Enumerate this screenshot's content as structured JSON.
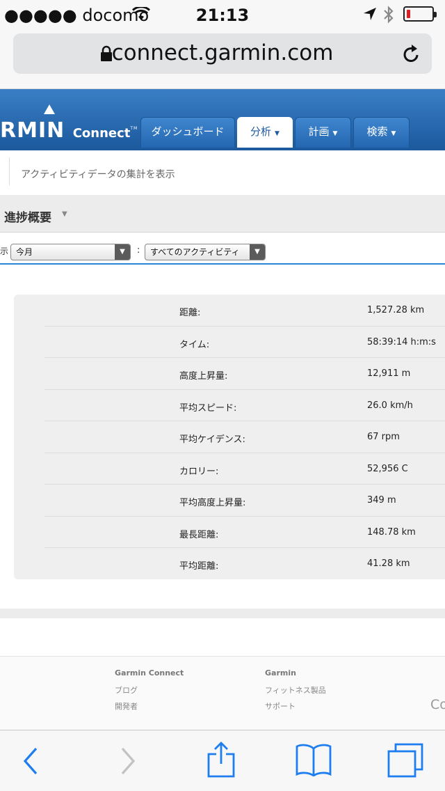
{
  "status_bar": {
    "carrier": "●●●●● docomo",
    "time": "21:13",
    "icons": [
      "wifi-icon",
      "location-arrow-icon",
      "bluetooth-icon",
      "battery-icon"
    ],
    "battery_color": "#e02020"
  },
  "url_bar": {
    "url": "connect.garmin.com",
    "icons": [
      "lock-icon",
      "reload-icon"
    ]
  },
  "garmin_header": {
    "logo_text": "RMIN",
    "logo_connect": "Connect",
    "logo_tm": "TM",
    "brand_color": "#1d5a9e",
    "tabs": [
      {
        "label": "ダッシュボード",
        "active": false
      },
      {
        "label": "分析",
        "active": true
      },
      {
        "label": "計画",
        "active": false
      },
      {
        "label": "検索",
        "active": false
      }
    ]
  },
  "subheader": {
    "text": "アクティビティデータの集計を表示"
  },
  "progress_section": {
    "title": "進捗概要"
  },
  "filters": {
    "prefix": "示",
    "period": "今月",
    "colon": ":",
    "activity": "すべてのアクティビティ"
  },
  "stats": [
    {
      "label": "距離:",
      "value": "1,527.28 km"
    },
    {
      "label": "タイム:",
      "value": "58:39:14 h:m:s"
    },
    {
      "label": "高度上昇量:",
      "value": "12,911 m"
    },
    {
      "label": "平均スピード:",
      "value": "26.0 km/h"
    },
    {
      "label": "平均ケイデンス:",
      "value": "67 rpm"
    },
    {
      "label": "カロリー:",
      "value": "52,956 C"
    },
    {
      "label": "平均高度上昇量:",
      "value": "349 m"
    },
    {
      "label": "最長距離:",
      "value": "148.78 km"
    },
    {
      "label": "平均距離:",
      "value": "41.28 km"
    }
  ],
  "footer": {
    "col1_title": "Garmin Connect",
    "col1_links": [
      "ブログ",
      "開発者"
    ],
    "col2_title": "Garmin",
    "col2_links": [
      "フィットネス製品",
      "サポート"
    ],
    "right_fragment": "Co"
  },
  "browser_toolbar": {
    "icons": [
      "back-icon",
      "forward-icon",
      "share-icon",
      "bookmarks-icon",
      "tabs-icon"
    ],
    "accent_color": "#1e7ef0"
  }
}
